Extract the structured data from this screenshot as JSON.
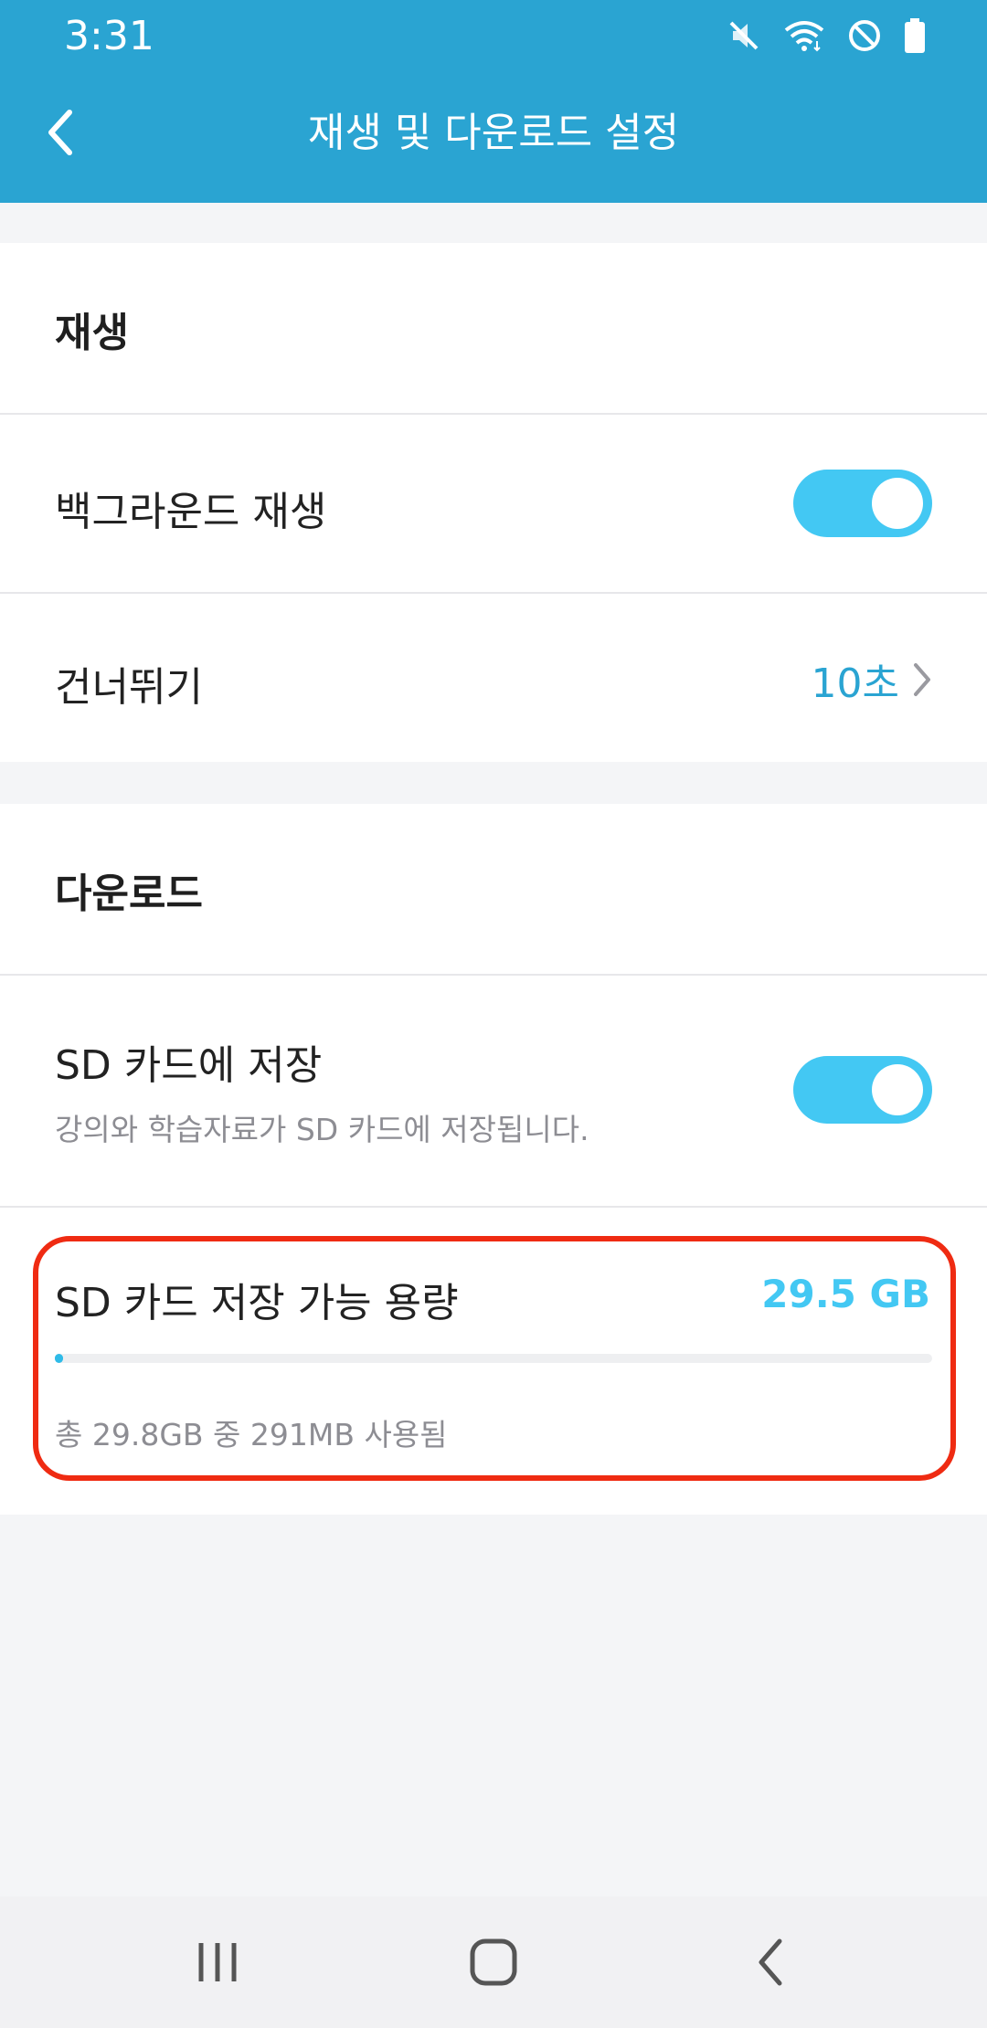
{
  "status_bar": {
    "time": "3:31",
    "icons": [
      "mute-icon",
      "wifi-icon",
      "do-not-disturb-icon",
      "battery-icon"
    ]
  },
  "app_bar": {
    "title": "재생 및 다운로드 설정",
    "back_icon": "chevron-left-icon"
  },
  "playback": {
    "header": "재생",
    "background_play": {
      "label": "백그라운드 재생",
      "enabled": true
    },
    "skip": {
      "label": "건너뛰기",
      "value": "10초"
    }
  },
  "download": {
    "header": "다운로드",
    "sd_save": {
      "label": "SD 카드에 저장",
      "description": "강의와 학습자료가 SD 카드에 저장됩니다.",
      "enabled": true
    },
    "capacity": {
      "label": "SD 카드 저장 가능 용량",
      "value": "29.5 GB",
      "usage_text": "총 29.8GB 중 291MB 사용됨",
      "used_fraction": 0.0095
    }
  },
  "nav_bar": {
    "icons": [
      "recent-apps-icon",
      "home-icon",
      "back-icon"
    ]
  },
  "colors": {
    "app_bar": "#2aa4d2",
    "accent": "#43c8f3",
    "highlight_border": "#ef2b12"
  }
}
